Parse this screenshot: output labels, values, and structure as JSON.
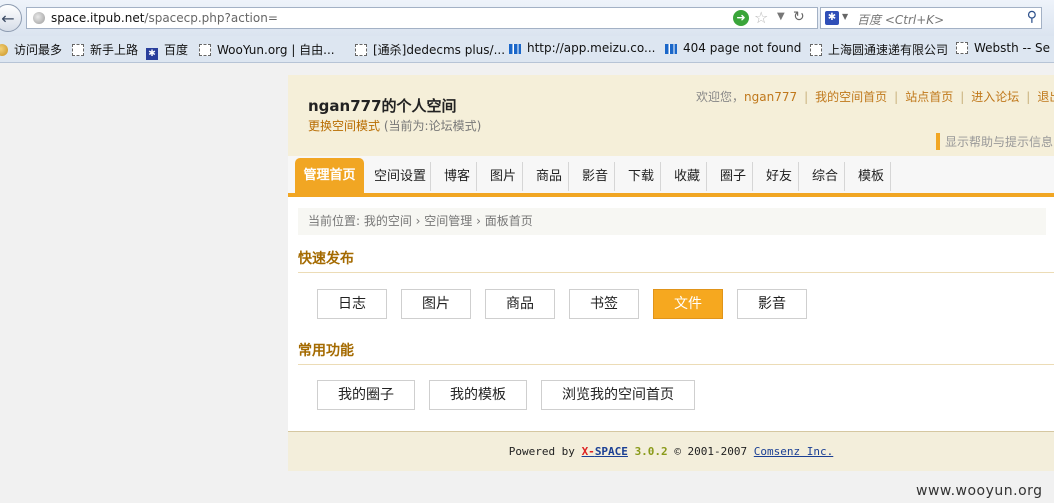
{
  "browser": {
    "url_host": "space.itpub.net",
    "url_path": "/spacecp.php?action=",
    "search_placeholder": "百度 <Ctrl+K>",
    "bookmarks": [
      {
        "label": "访问最多",
        "icon": "page-icon"
      },
      {
        "label": "新手上路",
        "icon": "page-icon"
      },
      {
        "label": "百度",
        "icon": "baidu-paw-icon"
      },
      {
        "label": "WooYun.org | 自由...",
        "icon": "page-icon"
      },
      {
        "label": "[通杀]dedecms plus/...",
        "icon": "page-icon"
      },
      {
        "label": "http://app.meizu.co...",
        "icon": "meizu-icon"
      },
      {
        "label": "404 page not found",
        "icon": "meizu-icon"
      },
      {
        "label": "上海圆通速递有限公司",
        "icon": "page-icon"
      },
      {
        "label": "Websth -- Se",
        "icon": "page-icon"
      }
    ]
  },
  "header": {
    "title": "ngan777的个人空间",
    "switch_mode": "更换空间模式",
    "mode_note": "(当前为:论坛模式)",
    "welcome": "欢迎您，",
    "username": "ngan777",
    "links": [
      "我的空间首页",
      "站点首页",
      "进入论坛",
      "退出"
    ],
    "help": "显示帮助与提示信息"
  },
  "tabs": {
    "active": "管理首页",
    "items": [
      "空间设置",
      "博客",
      "图片",
      "商品",
      "影音",
      "下载",
      "收藏",
      "圈子",
      "好友",
      "综合",
      "模板"
    ]
  },
  "breadcrumb": "当前位置: 我的空间 › 空间管理 › 面板首页",
  "quick_publish": {
    "title": "快速发布",
    "buttons": [
      "日志",
      "图片",
      "商品",
      "书签",
      "文件",
      "影音"
    ],
    "active_index": 4
  },
  "common_functions": {
    "title": "常用功能",
    "buttons": [
      "我的圈子",
      "我的模板",
      "浏览我的空间首页"
    ]
  },
  "footer": {
    "powered_by": "Powered by ",
    "x": "X-",
    "space": "SPACE",
    "version": "3.0.2",
    "copyright": "© 2001-2007",
    "company": "Comsenz Inc."
  },
  "watermark": "www.wooyun.org",
  "colors": {
    "accent": "#f1a623",
    "link": "#c0781b",
    "header_bg": "#f5efd9"
  }
}
